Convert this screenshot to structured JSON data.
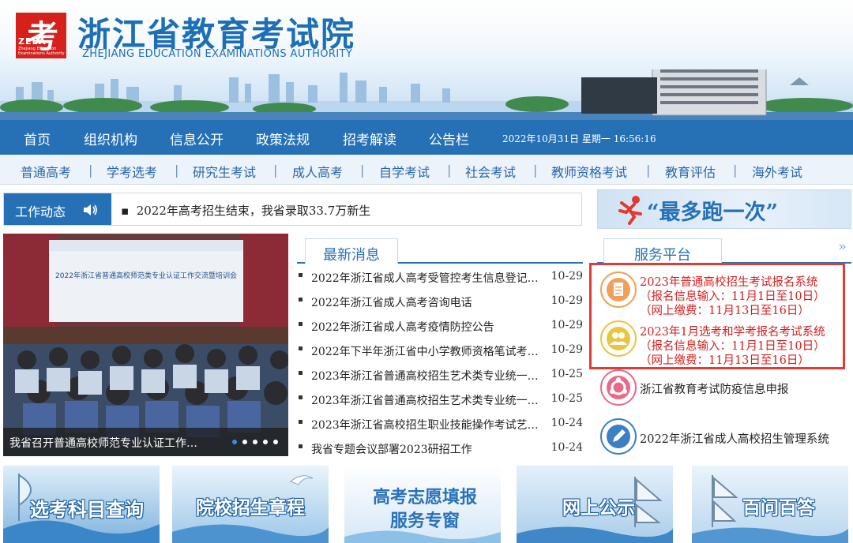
{
  "header": {
    "logo_glyph": "考",
    "logo_zeea": "ZEEA",
    "logo_sub1": "Zhejiang Education",
    "logo_sub2": "Examinations Authority",
    "title_cn": "浙江省教育考试院",
    "title_en": "ZHEJIANG EDUCATION EXAMINATIONS AUTHORITY"
  },
  "main_nav": {
    "items": [
      "首页",
      "组织机构",
      "信息公开",
      "政策法规",
      "招考解读",
      "公告栏"
    ],
    "datetime": "2022年10月31日 星期一 16:56:16"
  },
  "sub_nav": {
    "items": [
      "普通高考",
      "学考选考",
      "研究生考试",
      "成人高考",
      "自学考试",
      "社会考试",
      "教师资格考试",
      "教育评估",
      "海外考试"
    ],
    "separator": "|"
  },
  "ticker": {
    "label": "工作动态",
    "bullet": "▪",
    "text": "2022年高考招生结束，我省录取33.7万新生"
  },
  "zuiduo_banner": {
    "text": "“最多跑一次”"
  },
  "photo": {
    "slide_title": "2022年浙江省普通高校师范类专业认证工作交流暨培训会",
    "caption": "我省召开普通高校师范专业认证工作…",
    "dots": 5
  },
  "news": {
    "tab": "最新消息",
    "items": [
      {
        "title": "2022年浙江省成人高考受管控考生信息登记…",
        "date": "10-29"
      },
      {
        "title": "2022年浙江省成人高考咨询电话",
        "date": "10-29"
      },
      {
        "title": "2022年浙江省成人高考疫情防控公告",
        "date": "10-29"
      },
      {
        "title": "2022年下半年浙江省中小学教师资格笔试考…",
        "date": "10-29"
      },
      {
        "title": "2023年浙江省普通高校招生艺术类专业统一…",
        "date": "10-25"
      },
      {
        "title": "2023年浙江省普通高校招生艺术类专业统一…",
        "date": "10-25"
      },
      {
        "title": "2023年浙江省高校招生职业技能操作考试艺…",
        "date": "10-24"
      },
      {
        "title": "我省专题会议部署2023研招工作",
        "date": "10-24"
      }
    ]
  },
  "services": {
    "tab": "服务平台",
    "more": "»",
    "items": [
      {
        "title": "2023年普通高校招生考试报名系统",
        "line2": "（报名信息输入：11月1日至10日）",
        "line3": "（网上缴费：11月13日至16日）"
      },
      {
        "title": "2023年1月选考和学考报名考试系统",
        "line2": "（报名信息输入：11月1日至10日）",
        "line3": "（网上缴费：11月13日至16日）"
      },
      {
        "title": "浙江省教育考试防疫信息申报"
      },
      {
        "title": "2022年浙江省成人高校招生管理系统"
      }
    ],
    "colors": {
      "orange": "#f0a05a",
      "yellow": "#e8c640",
      "pink": "#e86a8a",
      "blue": "#3d7fc4"
    }
  },
  "bottom_banners": [
    {
      "text": "选考科目查询"
    },
    {
      "text": "院校招生章程"
    },
    {
      "text": "高考志愿填报",
      "text2": "服务专窗"
    },
    {
      "text": "网上公示"
    },
    {
      "text": "百问百答"
    }
  ]
}
